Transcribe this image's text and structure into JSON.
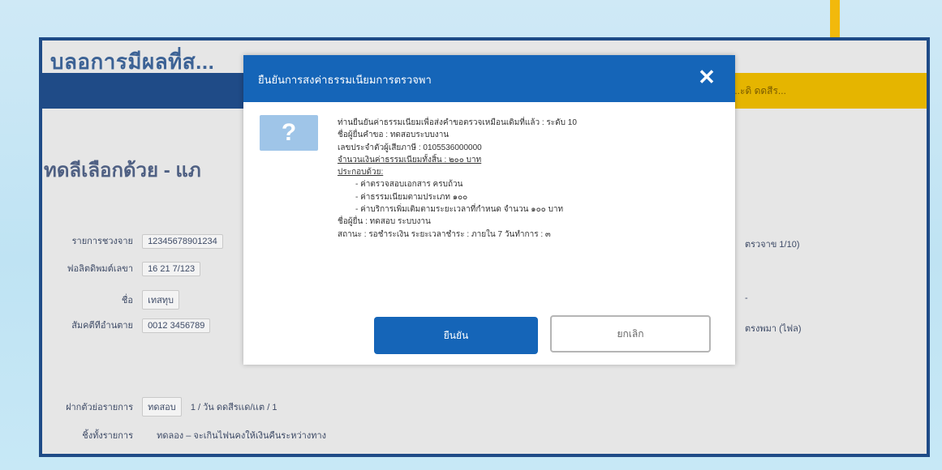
{
  "colors": {
    "primary": "#1565b8",
    "header_navy": "#1f4b87",
    "accent_yellow": "#e5b500",
    "background": "#cfe9f6"
  },
  "background_page": {
    "title": "บลอการมีผลที่ส...",
    "bar_yellow_text": "...ะดิ ดดสีร...",
    "heading": "ทดลีเลือกด้วย - แภ",
    "rows": [
      {
        "label": "รายการชวงจาย",
        "value": "12345678901234"
      },
      {
        "label": "ฟอลิตดิพมต์เลขา",
        "value": "16 21 7/123"
      },
      {
        "label": "ชื่อ",
        "value": "เทสทุบ"
      },
      {
        "label": "สัมคตีทีอำนตาย",
        "value": "0012 3456789"
      }
    ],
    "right_values": [
      "ตรวจาข 1/10)",
      "-",
      "ตรงพมา (ไฟล)"
    ],
    "bottom_rows": [
      {
        "label": "ฝากตัวย่อรายการ",
        "value": "ทดสอบ",
        "extra": "1 / วัน ดดสีรเเด/เเต / 1"
      },
      {
        "label": "ชิ้งทั้งรายการ",
        "value": "",
        "extra": "ทดลอง – จะเกินไฟนคงให้เงินคืนระหว่างทาง"
      }
    ]
  },
  "modal": {
    "title": "ยืนยันการสงค่าธรรมเนียมการตรวจพา",
    "close_icon": "close-icon",
    "question_icon": "question-icon",
    "question_mark": "?",
    "body_lines": [
      {
        "text": "ท่านยืนยันค่าธรรมเนียมเพื่อส่งคำขอตรวจเหมือนเดิมที่แล้ว : ระดับ 10",
        "style": ""
      },
      {
        "text": "ชื่อผู้ยื่นคำขอ : ทดสอบระบบงาน",
        "style": ""
      },
      {
        "text": "เลขประจำตัวผู้เสียภาษี : 0105536000000",
        "style": ""
      },
      {
        "text": "จำนวนเงินค่าธรรมเนียมทั้งสิ้น : ๒๐๐ บาท",
        "style": "ul"
      },
      {
        "text": "ประกอบด้วย:",
        "style": "ul"
      },
      {
        "text": "- ค่าตรวจสอบเอกสาร ครบถ้วน",
        "style": "indent"
      },
      {
        "text": "- ค่าธรรมเนียมตามประเภท ๑๐๐",
        "style": "indent"
      },
      {
        "text": "- ค่าบริการเพิ่มเติมตามระยะเวลาที่กำหนด จำนวน ๑๐๐ บาท",
        "style": "indent"
      },
      {
        "text": "ชื่อผู้ยื่น : ทดสอบ ระบบงาน",
        "style": ""
      },
      {
        "text": "สถานะ : รอชำระเงิน    ระยะเวลาชำระ : ภายใน 7 วันทำการ : ๓",
        "style": ""
      }
    ],
    "confirm_label": "ยืนยัน",
    "cancel_label": "ยกเลิก"
  }
}
